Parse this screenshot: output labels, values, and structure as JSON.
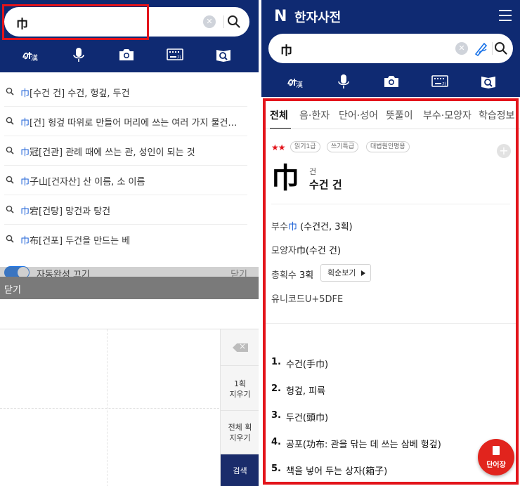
{
  "left": {
    "search": {
      "value": "巾",
      "clear_icon": "clear-circle-icon",
      "search_icon": "search-icon"
    },
    "icons": [
      "handwriting-icon",
      "microphone-icon",
      "camera-icon",
      "keyboard-icon",
      "book-search-icon"
    ],
    "suggestions": [
      {
        "hanja": "巾",
        "rest": "[수건 건] 수건, 헝겊, 두건"
      },
      {
        "hanja": "巾",
        "rest": "[건] 헝겊 따위로 만들어 머리에 쓰는 여러 가지 물건의 통..."
      },
      {
        "hanja": "巾",
        "rest": "冠[건관] 관례 때에 쓰는 관, 성인이 되는 것"
      },
      {
        "hanja": "巾",
        "rest": "子山[건자산] 산 이름, 소 이름"
      },
      {
        "hanja": "巾",
        "rest": "宕[건탕] 망건과 탕건"
      },
      {
        "hanja": "巾",
        "rest": "布[건포] 두건을 만드는 베"
      }
    ],
    "autocomplete": {
      "label": "자동완성 끄기",
      "close": "닫기"
    },
    "dim_close": "닫기",
    "pad": {
      "one_delete": [
        "1획",
        "지우기"
      ],
      "all_delete": [
        "전체 획",
        "지우기"
      ],
      "search": "검색"
    }
  },
  "right": {
    "title": "한자사전",
    "logo": "N",
    "search": {
      "value": "巾"
    },
    "icons": [
      "handwriting-icon",
      "microphone-icon",
      "camera-icon",
      "keyboard-icon",
      "book-search-icon"
    ],
    "tabs": [
      "전체",
      "음·한자",
      "단어·성어",
      "뜻풀이",
      "부수·모양자",
      "학습정보"
    ],
    "stars": "★★",
    "badges": [
      "읽기1급",
      "쓰기특급",
      "대법원인명용"
    ],
    "entry": {
      "char": "巾",
      "reading": "건",
      "meaning": "수건 건"
    },
    "info": {
      "radical_label": "부수",
      "radical_hanja": "巾",
      "radical_value": "(수건건, 3획)",
      "shape_label": "모양자",
      "shape_value": "巾(수건 건)",
      "strokes_label": "총획수",
      "strokes_value": "3획",
      "stroke_button": "획순보기",
      "unicode_label": "유니코드",
      "unicode_value": "U+5DFE"
    },
    "definitions": [
      {
        "num": "1.",
        "text": "수건(手巾)"
      },
      {
        "num": "2.",
        "text": "헝겊, 피륙"
      },
      {
        "num": "3.",
        "text": "두건(頭巾)"
      },
      {
        "num": "4.",
        "text": "공포(功布: 관을 닦는 데 쓰는 삼베 헝겊)"
      },
      {
        "num": "5.",
        "text": "책을 넣어 두는 상자(箱子)"
      }
    ],
    "fab_label": "단어장",
    "colors": {
      "header": "#0f2a72",
      "highlight": "#e3141b",
      "link": "#1a5fd6"
    }
  }
}
